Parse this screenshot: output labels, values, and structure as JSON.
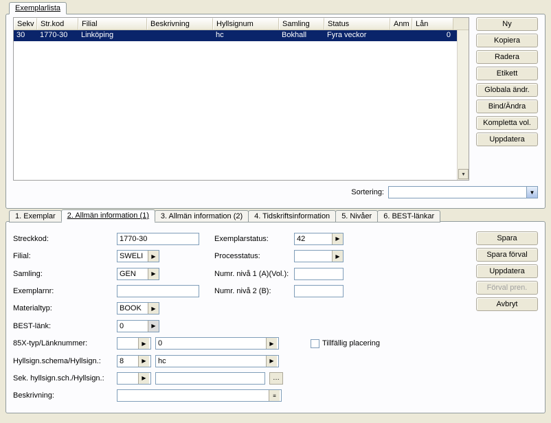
{
  "top": {
    "tabs": [
      {
        "label": "Exemplarlista",
        "active": true
      }
    ],
    "columns": [
      "Sekv",
      "Str.kod",
      "Filial",
      "Beskrivning",
      "Hyllsignum",
      "Samling",
      "Status",
      "Anm",
      "Lån"
    ],
    "rows": [
      {
        "sekv": "30",
        "strkod": "1770-30",
        "filial": "Linköping",
        "beskrivning": "",
        "hyllsignum": "hc",
        "samling": "Bokhall",
        "status": "Fyra veckor",
        "anm": "",
        "lan": "0"
      }
    ],
    "sort_label": "Sortering:",
    "sort_value": "",
    "buttons": {
      "ny": "Ny",
      "kopiera": "Kopiera",
      "radera": "Radera",
      "etikett": "Etikett",
      "globala": "Globala ändr.",
      "bind": "Bind/Ändra",
      "kompletta": "Kompletta vol.",
      "uppdatera": "Uppdatera"
    }
  },
  "bottom": {
    "tabs": [
      {
        "label": "1. Exemplar"
      },
      {
        "label": "2. Allmän information (1)",
        "active": true
      },
      {
        "label": "3. Allmän information (2)"
      },
      {
        "label": "4. Tidskriftsinformation"
      },
      {
        "label": "5. Nivåer"
      },
      {
        "label": "6. BEST-länkar"
      }
    ],
    "fields": {
      "streckkod_label": "Streckkod:",
      "streckkod": "1770-30",
      "filial_label": "Filial:",
      "filial": "SWELI",
      "samling_label": "Samling:",
      "samling": "GEN",
      "exemplarnr_label": "Exemplarnr:",
      "exemplarnr": "",
      "materialtyp_label": "Materialtyp:",
      "materialtyp": "BOOK",
      "bestlank_label": "BEST-länk:",
      "bestlank": "0",
      "x85x_label": "85X-typ/Länknummer:",
      "x85x_a": "",
      "x85x_b": "0",
      "hyllsign_label": "Hyllsign.schema/Hyllsign.:",
      "hyllsign_a": "8",
      "hyllsign_b": "hc",
      "sekhyll_label": "Sek. hyllsign.sch./Hyllsign.:",
      "sekhyll_a": "",
      "sekhyll_b": "",
      "beskrivning_label": "Beskrivning:",
      "beskrivning": "",
      "exemplarstatus_label": "Exemplarstatus:",
      "exemplarstatus": "42",
      "processtatus_label": "Processtatus:",
      "processtatus": "",
      "numr1_label": "Numr. nivå 1 (A)(Vol.):",
      "numr1": "",
      "numr2_label": "Numr. nivå 2  (B):",
      "numr2": "",
      "tillfallig_label": "Tillfällig placering"
    },
    "buttons": {
      "spara": "Spara",
      "spara_forval": "Spara förval",
      "uppdatera": "Uppdatera",
      "forval_pren": "Förval pren.",
      "avbryt": "Avbryt"
    }
  }
}
